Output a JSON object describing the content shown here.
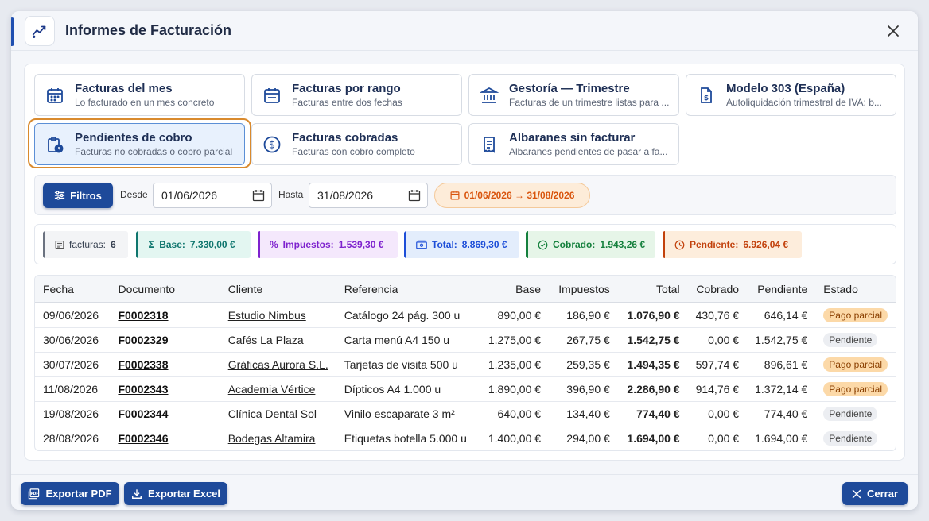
{
  "window": {
    "title": "Informes de Facturación",
    "accent": "#1f4fb0"
  },
  "report_cards": [
    {
      "title": "Facturas del mes",
      "subtitle": "Lo facturado en un mes concreto",
      "icon": "calendar-icon"
    },
    {
      "title": "Facturas por rango",
      "subtitle": "Facturas entre dos fechas",
      "icon": "calendar-icon"
    },
    {
      "title": "Gestoría — Trimestre",
      "subtitle": "Facturas de un trimestre listas para ...",
      "icon": "bank-icon"
    },
    {
      "title": "Modelo 303 (España)",
      "subtitle": "Autoliquidación trimestral de IVA: b...",
      "icon": "tax-document-icon"
    },
    {
      "title": "Pendientes de cobro",
      "subtitle": "Facturas no cobradas o cobro parcial",
      "icon": "clipboard-clock-icon",
      "active": true
    },
    {
      "title": "Facturas cobradas",
      "subtitle": "Facturas con cobro completo",
      "icon": "dollar-circle-icon"
    },
    {
      "title": "Albaranes sin facturar",
      "subtitle": "Albaranes pendientes de pasar a fa...",
      "icon": "receipt-icon"
    }
  ],
  "filters": {
    "button_label": "Filtros",
    "desde_label": "Desde",
    "desde_value": "01/06/2026",
    "hasta_label": "Hasta",
    "hasta_value": "31/08/2026",
    "range_badge": "01/06/2026 → 31/08/2026"
  },
  "stats": [
    {
      "label": "facturas:",
      "value": "6",
      "color": "#6b7280",
      "bg": "#f3f4f6",
      "icon": "list-icon"
    },
    {
      "label": "Base:",
      "value": "7.330,00 €",
      "color": "#0f766e",
      "bg": "#e3f6f1",
      "icon": "sigma-icon"
    },
    {
      "label": "Impuestos:",
      "value": "1.539,30 €",
      "color": "#7e22ce",
      "bg": "#f4e8fc",
      "icon": "percent-icon"
    },
    {
      "label": "Total:",
      "value": "8.869,30 €",
      "color": "#1d4ed8",
      "bg": "#e3edfc",
      "icon": "cash-icon"
    },
    {
      "label": "Cobrado:",
      "value": "1.943,26 €",
      "color": "#15803d",
      "bg": "#e6f5e8",
      "icon": "check-circle-icon"
    },
    {
      "label": "Pendiente:",
      "value": "6.926,04 €",
      "color": "#c2410c",
      "bg": "#fdeddc",
      "icon": "clock-icon"
    }
  ],
  "table": {
    "headers": [
      "Fecha",
      "Documento",
      "Cliente",
      "Referencia",
      "Base",
      "Impuestos",
      "Total",
      "Cobrado",
      "Pendiente",
      "Estado"
    ],
    "rows": [
      [
        "09/06/2026",
        "F0002318",
        "Estudio Nimbus",
        "Catálogo 24 pág. 300 u",
        "890,00 €",
        "186,90 €",
        "1.076,90 €",
        "430,76 €",
        "646,14 €",
        "Pago parcial"
      ],
      [
        "30/06/2026",
        "F0002329",
        "Cafés La Plaza",
        "Carta menú A4 150 u",
        "1.275,00 €",
        "267,75 €",
        "1.542,75 €",
        "0,00 €",
        "1.542,75 €",
        "Pendiente"
      ],
      [
        "30/07/2026",
        "F0002338",
        "Gráficas Aurora S.L.",
        "Tarjetas de visita 500 u",
        "1.235,00 €",
        "259,35 €",
        "1.494,35 €",
        "597,74 €",
        "896,61 €",
        "Pago parcial"
      ],
      [
        "11/08/2026",
        "F0002343",
        "Academia Vértice",
        "Dípticos A4 1.000 u",
        "1.890,00 €",
        "396,90 €",
        "2.286,90 €",
        "914,76 €",
        "1.372,14 €",
        "Pago parcial"
      ],
      [
        "19/08/2026",
        "F0002344",
        "Clínica Dental Sol",
        "Vinilo escaparate 3 m²",
        "640,00 €",
        "134,40 €",
        "774,40 €",
        "0,00 €",
        "774,40 €",
        "Pendiente"
      ],
      [
        "28/08/2026",
        "F0002346",
        "Bodegas Altamira",
        "Etiquetas botella 5.000 u",
        "1.400,00 €",
        "294,00 €",
        "1.694,00 €",
        "0,00 €",
        "1.694,00 €",
        "Pendiente"
      ]
    ]
  },
  "footer": {
    "export_pdf": "Exportar PDF",
    "export_excel": "Exportar Excel",
    "close": "Cerrar"
  }
}
